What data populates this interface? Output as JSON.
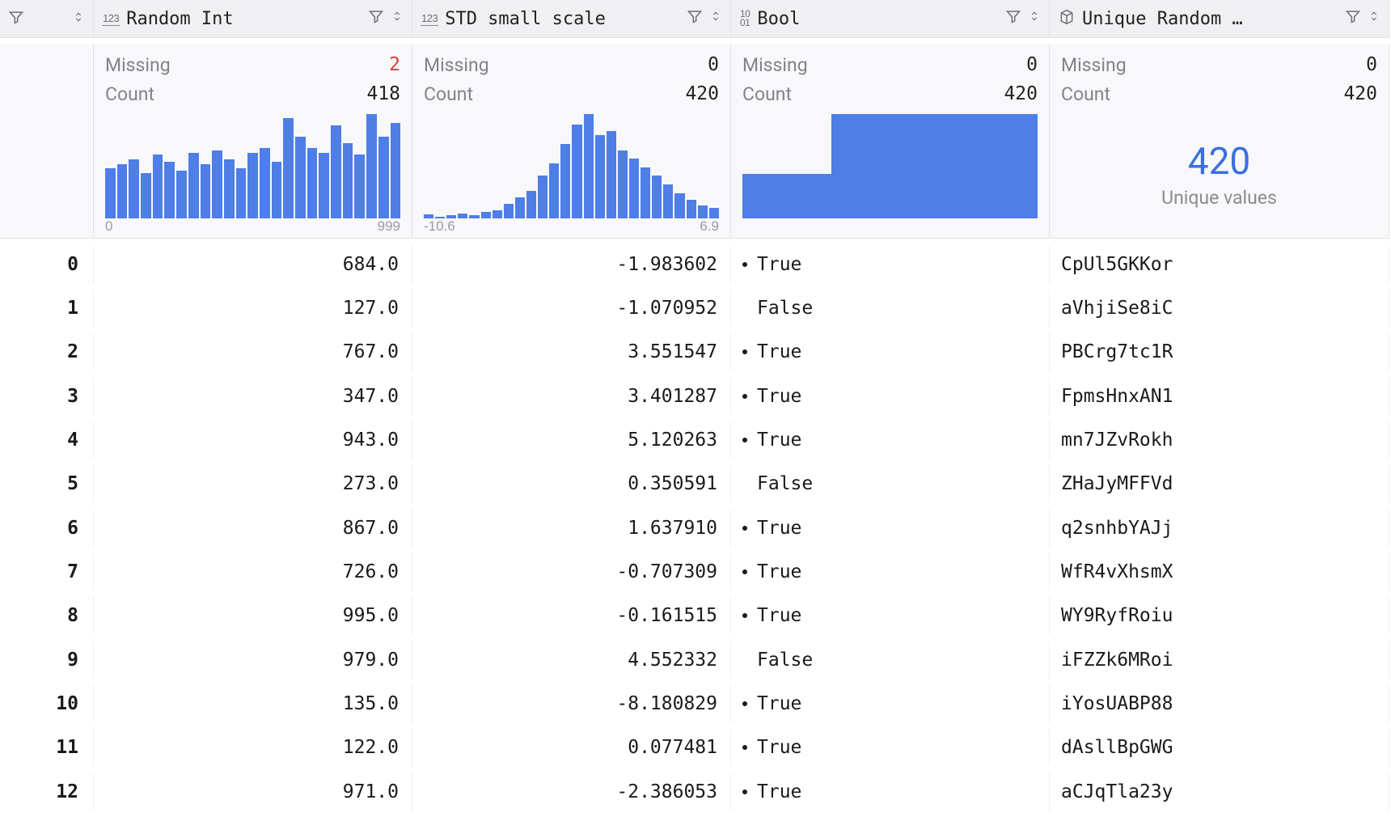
{
  "columns": [
    {
      "name": "Random Int",
      "type": "123",
      "missing": 2,
      "missing_red": true,
      "count": 418,
      "axis_min": "0",
      "axis_max": "999",
      "hist": [
        44,
        48,
        52,
        40,
        56,
        50,
        42,
        58,
        48,
        60,
        52,
        44,
        58,
        62,
        50,
        88,
        72,
        62,
        58,
        82,
        66,
        56,
        92,
        72,
        84
      ]
    },
    {
      "name": "STD small scale",
      "type": "123",
      "missing": 0,
      "missing_red": false,
      "count": 420,
      "axis_min": "-10.6",
      "axis_max": "6.9",
      "hist": [
        4,
        2,
        3,
        5,
        3,
        6,
        8,
        14,
        20,
        26,
        40,
        52,
        70,
        88,
        98,
        78,
        82,
        64,
        56,
        48,
        40,
        32,
        24,
        18,
        12,
        10
      ]
    },
    {
      "name": "Bool",
      "type": "bool",
      "missing": 0,
      "missing_red": false,
      "count": 420,
      "bool_split": [
        0.3,
        0.7
      ]
    },
    {
      "name": "Unique Random …",
      "type": "cube",
      "missing": 0,
      "missing_red": false,
      "count": 420,
      "unique_count": 420,
      "unique_label": "Unique values"
    }
  ],
  "stat_labels": {
    "missing": "Missing",
    "count": "Count"
  },
  "rows": [
    {
      "idx": "0",
      "c0": "684.0",
      "c1": "-1.983602",
      "c2": "True",
      "c3": "CpUl5GKKor"
    },
    {
      "idx": "1",
      "c0": "127.0",
      "c1": "-1.070952",
      "c2": "False",
      "c3": "aVhjiSe8iC"
    },
    {
      "idx": "2",
      "c0": "767.0",
      "c1": "3.551547",
      "c2": "True",
      "c3": "PBCrg7tc1R"
    },
    {
      "idx": "3",
      "c0": "347.0",
      "c1": "3.401287",
      "c2": "True",
      "c3": "FpmsHnxAN1"
    },
    {
      "idx": "4",
      "c0": "943.0",
      "c1": "5.120263",
      "c2": "True",
      "c3": "mn7JZvRokh"
    },
    {
      "idx": "5",
      "c0": "273.0",
      "c1": "0.350591",
      "c2": "False",
      "c3": "ZHaJyMFFVd"
    },
    {
      "idx": "6",
      "c0": "867.0",
      "c1": "1.637910",
      "c2": "True",
      "c3": "q2snhbYAJj"
    },
    {
      "idx": "7",
      "c0": "726.0",
      "c1": "-0.707309",
      "c2": "True",
      "c3": "WfR4vXhsmX"
    },
    {
      "idx": "8",
      "c0": "995.0",
      "c1": "-0.161515",
      "c2": "True",
      "c3": "WY9RyfRoiu"
    },
    {
      "idx": "9",
      "c0": "979.0",
      "c1": "4.552332",
      "c2": "False",
      "c3": "iFZZk6MRoi"
    },
    {
      "idx": "10",
      "c0": "135.0",
      "c1": "-8.180829",
      "c2": "True",
      "c3": "iYosUABP88"
    },
    {
      "idx": "11",
      "c0": "122.0",
      "c1": "0.077481",
      "c2": "True",
      "c3": "dAsllBpGWG"
    },
    {
      "idx": "12",
      "c0": "971.0",
      "c1": "-2.386053",
      "c2": "True",
      "c3": "aCJqTla23y"
    }
  ],
  "chart_data": [
    {
      "type": "bar",
      "title": "Random Int distribution",
      "xrange": [
        0,
        999
      ],
      "values": [
        44,
        48,
        52,
        40,
        56,
        50,
        42,
        58,
        48,
        60,
        52,
        44,
        58,
        62,
        50,
        88,
        72,
        62,
        58,
        82,
        66,
        56,
        92,
        72,
        84
      ]
    },
    {
      "type": "bar",
      "title": "STD small scale distribution",
      "xrange": [
        -10.6,
        6.9
      ],
      "values": [
        4,
        2,
        3,
        5,
        3,
        6,
        8,
        14,
        20,
        26,
        40,
        52,
        70,
        88,
        98,
        78,
        82,
        64,
        56,
        48,
        40,
        32,
        24,
        18,
        12,
        10
      ]
    },
    {
      "type": "bar",
      "title": "Bool counts",
      "categories": [
        "False",
        "True"
      ],
      "values": [
        126,
        294
      ]
    }
  ]
}
